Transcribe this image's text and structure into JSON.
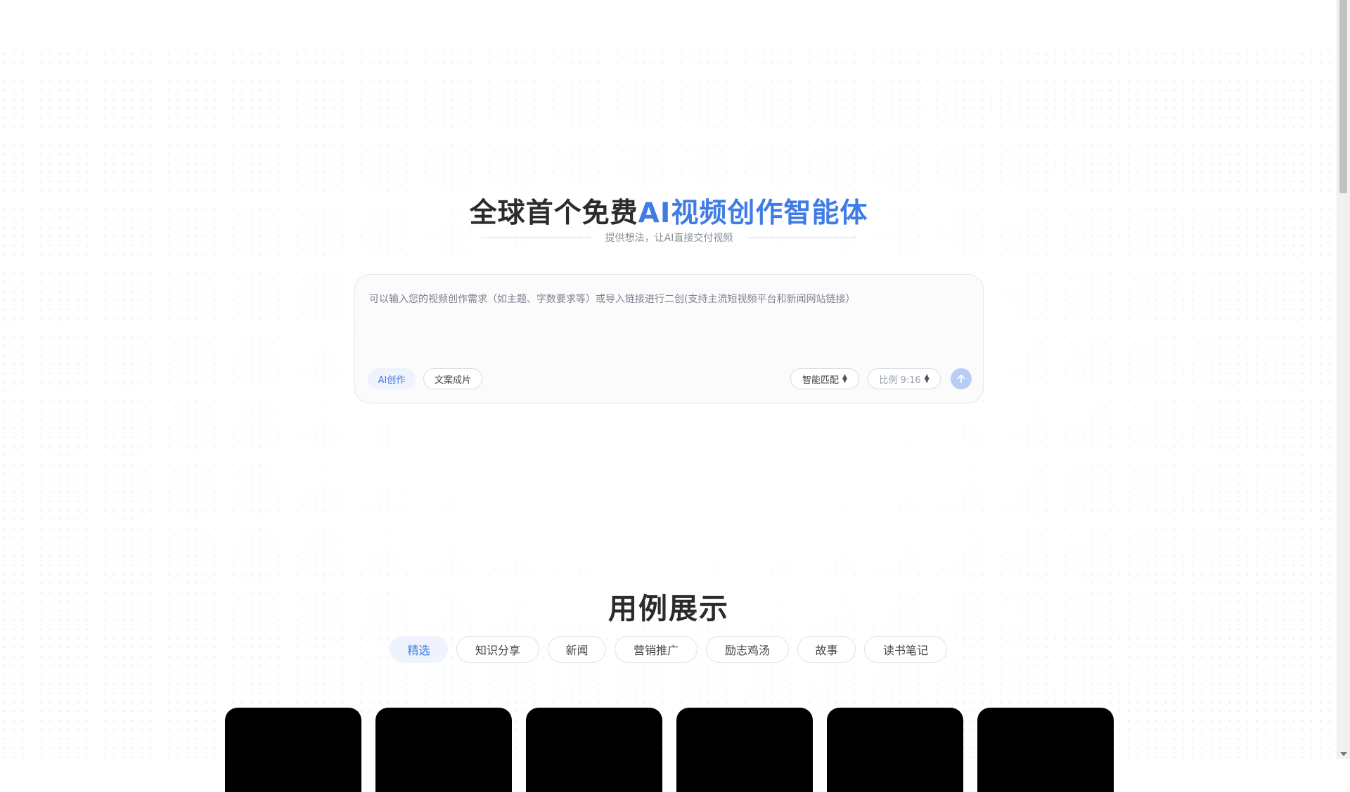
{
  "hero": {
    "title_plain": "全球首个免费",
    "title_accent": "AI视频创作智能体",
    "subtitle": "提供想法，让AI直接交付视频"
  },
  "prompt": {
    "placeholder": "可以输入您的视频创作需求（如主题、字数要求等）或导入链接进行二创(支持主流短视频平台和新闻网站链接）",
    "mode_ai": "AI创作",
    "mode_copy": "文案成片",
    "match_label": "智能匹配",
    "ratio_label": "比例 9:16",
    "send_icon": "arrow-up-icon"
  },
  "showcase": {
    "title": "用例展示",
    "tabs": [
      {
        "label": "精选",
        "active": true
      },
      {
        "label": "知识分享",
        "active": false
      },
      {
        "label": "新闻",
        "active": false
      },
      {
        "label": "营销推广",
        "active": false
      },
      {
        "label": "励志鸡汤",
        "active": false
      },
      {
        "label": "故事",
        "active": false
      },
      {
        "label": "读书笔记",
        "active": false
      }
    ]
  },
  "colors": {
    "accent": "#3f7ce5",
    "accent_bg": "#eef3fd",
    "send_button": "#b8cdf3",
    "card": "#000000"
  }
}
